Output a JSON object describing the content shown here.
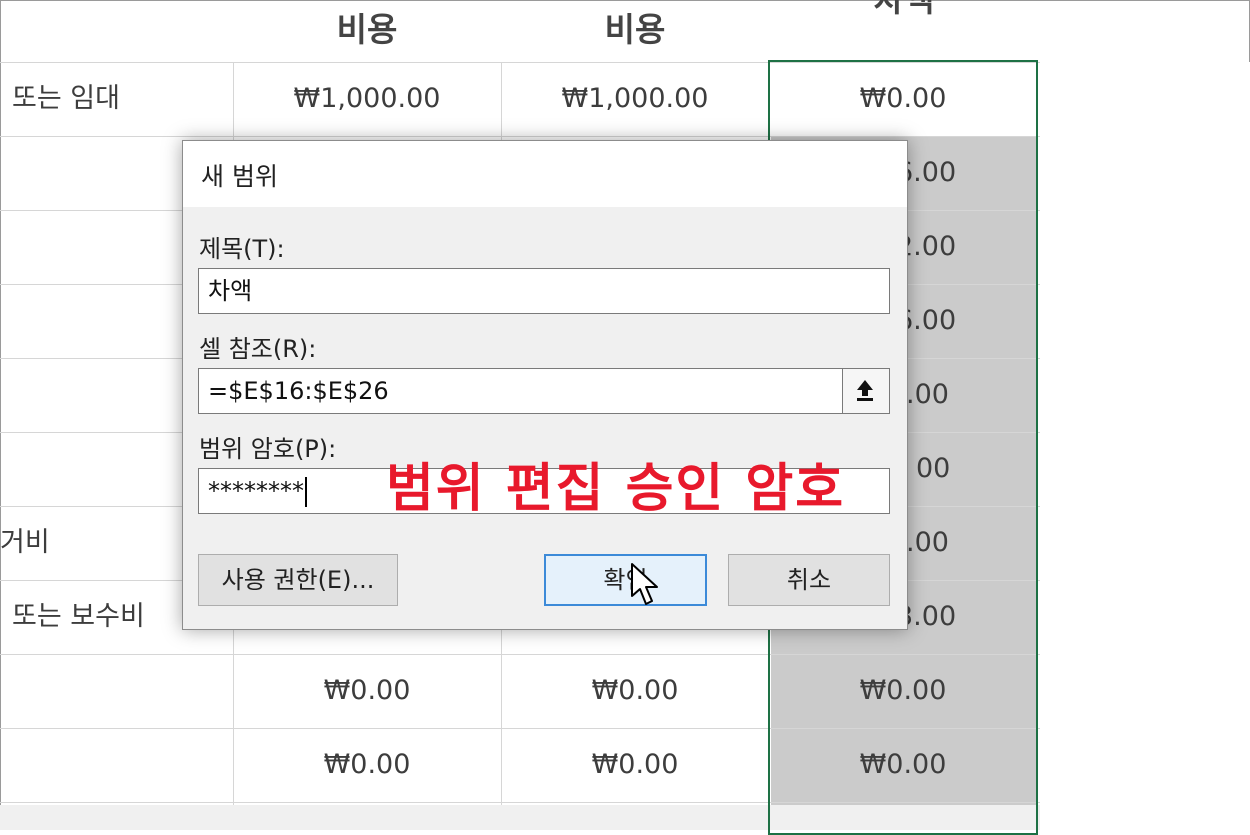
{
  "sheet": {
    "headers": [
      "비용",
      "비용",
      "차액"
    ],
    "row_labels": [
      "또는 임대",
      "거비",
      "또는 보수비"
    ],
    "rows": [
      [
        "₩1,000.00",
        "₩1,000.00",
        "₩0.00"
      ],
      [
        "₩0.00",
        "₩0.00",
        "₩0.00"
      ],
      [
        "₩0.00",
        "₩0.00",
        "₩0.00"
      ]
    ],
    "hidden_right_fragments": [
      "6.00",
      "2.00",
      "6.00",
      ".00",
      "00",
      ".00",
      "3.00"
    ]
  },
  "dialog": {
    "title": "새 범위",
    "title_label": "제목(T):",
    "title_value": "차액",
    "ref_label": "셀 참조(R):",
    "ref_value": "=$E$16:$E$26",
    "pwd_label": "범위 암호(P):",
    "pwd_value": "********",
    "permissions_button": "사용 권한(E)...",
    "ok_button": "확인",
    "cancel_button": "취소"
  },
  "annotation": "범위 편집 승인 암호",
  "colors": {
    "selection_border": "#1e7145",
    "annotation": "#e8192c",
    "default_button_border": "#3c8ad8"
  }
}
